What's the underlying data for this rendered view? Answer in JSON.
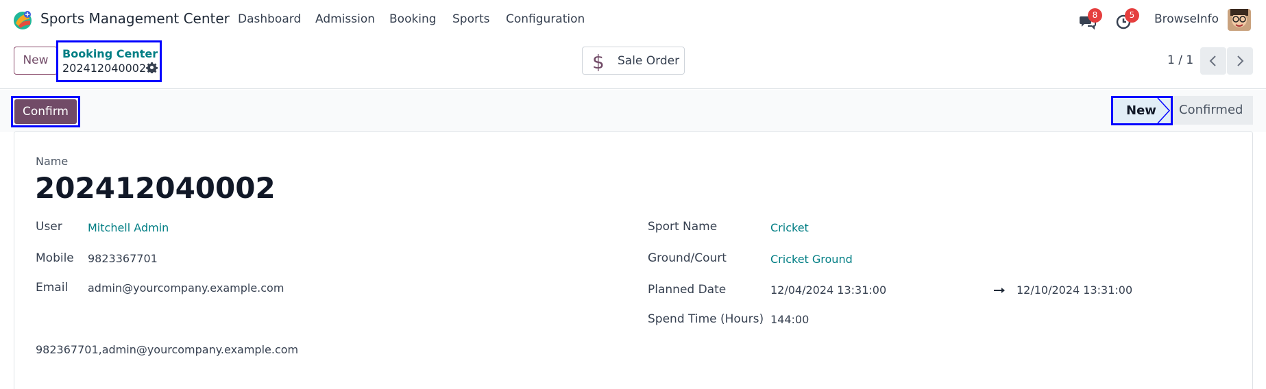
{
  "app": {
    "title": "Sports Management Center"
  },
  "nav": {
    "items": [
      "Dashboard",
      "Admission",
      "Booking",
      "Sports",
      "Configuration"
    ],
    "messages_badge": "8",
    "activities_badge": "5",
    "company": "BrowseInfo"
  },
  "control_panel": {
    "new_label": "New",
    "breadcrumb_parent": "Booking Center",
    "breadcrumb_current": "202412040002",
    "sale_order_label": "Sale Order",
    "pager": "1 / 1"
  },
  "status_bar": {
    "confirm_label": "Confirm",
    "stages": [
      "New",
      "Confirmed"
    ],
    "active_stage": "New"
  },
  "form": {
    "name_label": "Name",
    "name_value": "202412040002",
    "user_label": "User",
    "user_value": "Mitchell Admin",
    "mobile_label": "Mobile",
    "mobile_value": "9823367701",
    "email_label": "Email",
    "email_value": "admin@yourcompany.example.com",
    "contact_summary": "982367701,admin@yourcompany.example.com",
    "sport_label": "Sport Name",
    "sport_value": "Cricket",
    "ground_label": "Ground/Court",
    "ground_value": "Cricket Ground",
    "planned_label": "Planned Date",
    "planned_start": "12/04/2024 13:31:00",
    "planned_end": "12/10/2024 13:31:00",
    "spend_label": "Spend Time (Hours)",
    "spend_value": "144:00"
  },
  "colors": {
    "brand": "#714b67",
    "link": "#017e84",
    "badge": "#e53e3e",
    "highlight_box": "#0000ff"
  },
  "icons": [
    "app-logo-icon",
    "chat-icon",
    "clock-icon",
    "gear-icon",
    "dollar-icon",
    "chevron-left-icon",
    "chevron-right-icon",
    "arrow-right-icon"
  ]
}
